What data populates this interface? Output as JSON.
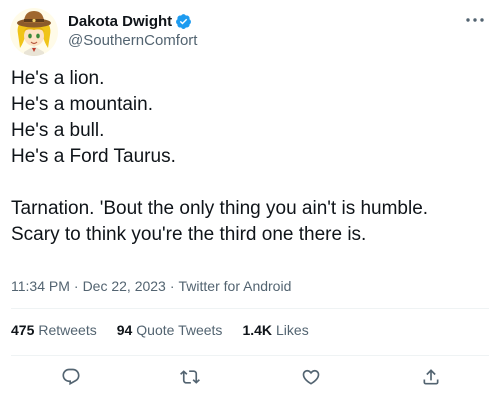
{
  "user": {
    "display_name": "Dakota Dwight",
    "handle": "@SouthernComfort",
    "verified": true,
    "avatar_icon": "anime-character-cowboy-hat-avatar"
  },
  "more_icon": "ellipsis-icon",
  "tweet": {
    "lines": [
      "He's a lion.",
      "He's a mountain.",
      "He's a bull.",
      "He's a Ford Taurus.",
      "",
      "Tarnation. 'Bout the only thing you ain't is humble.",
      "Scary to think you're the third one there is."
    ]
  },
  "meta": {
    "time": "11:34 PM",
    "separator": "·",
    "date": "Dec 22, 2023",
    "source": "Twitter for Android"
  },
  "stats": {
    "retweets": {
      "count": "475",
      "label": "Retweets"
    },
    "quotes": {
      "count": "94",
      "label": "Quote Tweets"
    },
    "likes": {
      "count": "1.4K",
      "label": "Likes"
    }
  },
  "actions": [
    "reply-icon",
    "retweet-icon",
    "like-icon",
    "share-icon"
  ],
  "colors": {
    "text": "#0f1419",
    "secondary": "#536471",
    "verified": "#1d9bf0",
    "divider": "#eff3f4"
  }
}
